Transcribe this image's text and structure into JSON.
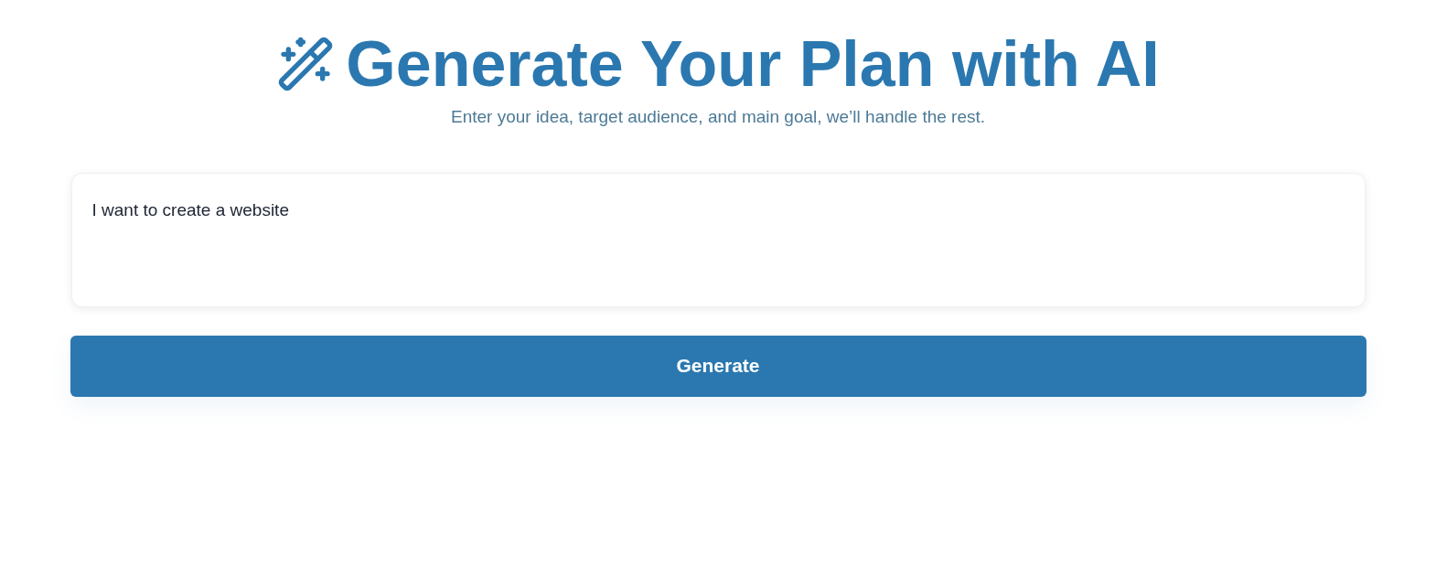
{
  "header": {
    "title": "Generate Your Plan with AI",
    "subtitle": "Enter your idea, target audience, and main goal, we’ll handle the rest."
  },
  "prompt": {
    "value": "I want to create a website"
  },
  "button": {
    "label": "Generate"
  }
}
